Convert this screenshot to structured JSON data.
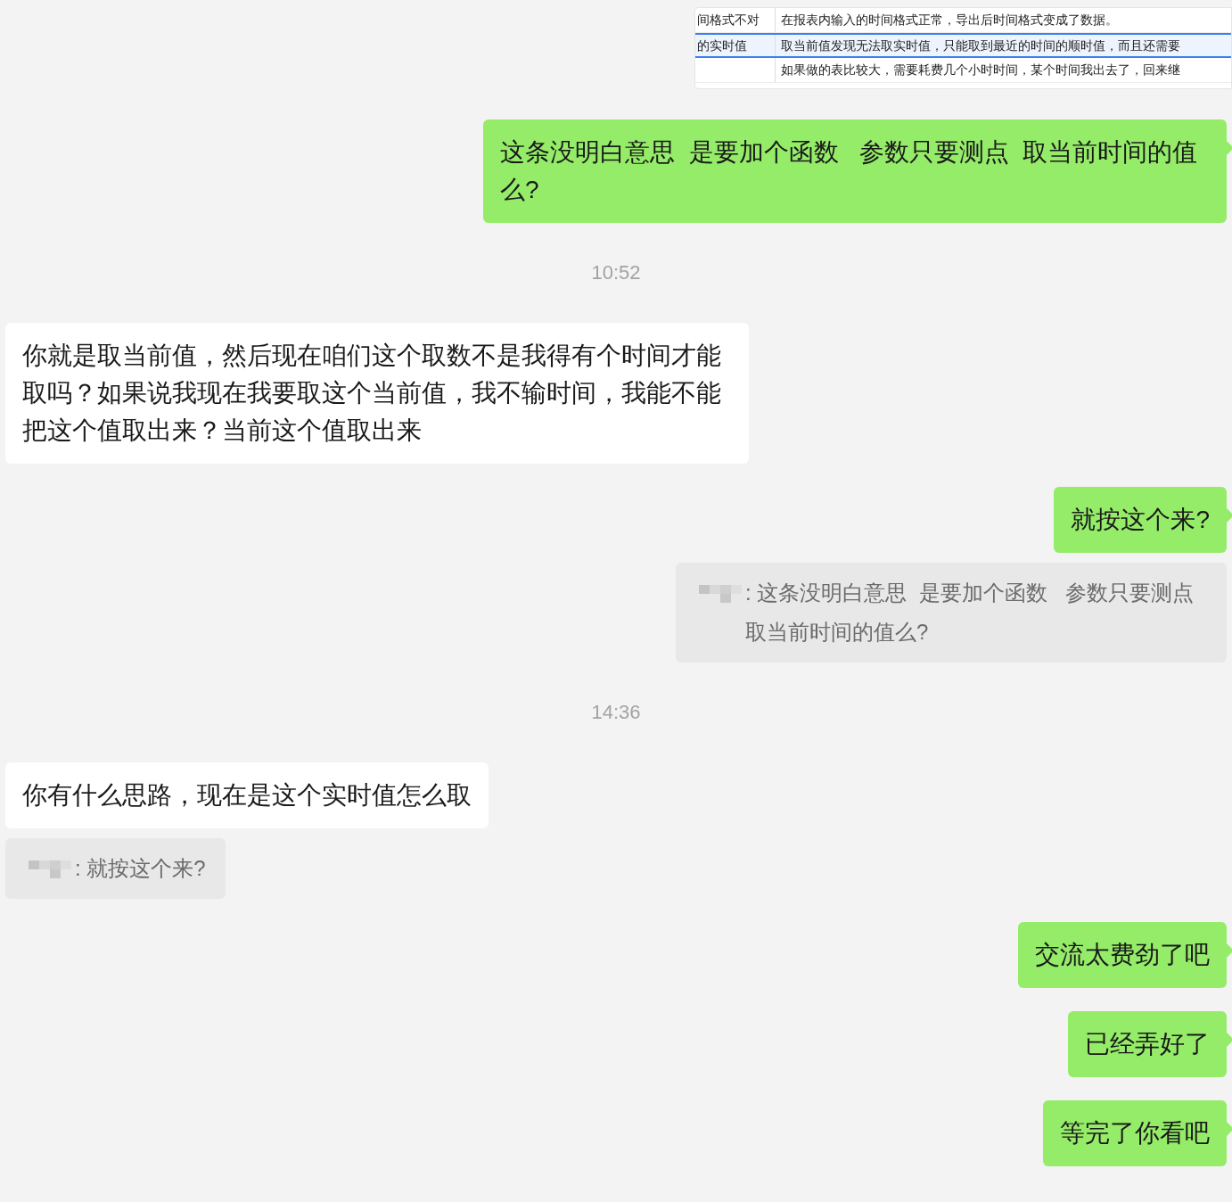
{
  "messages": [
    {
      "kind": "table-image",
      "outgoing": true,
      "rows": [
        {
          "cells": [
            "间格式不对",
            "在报表内输入的时间格式正常，导出后时间格式变成了数据。"
          ],
          "selected": false
        },
        {
          "cells": [
            "的实时值",
            "取当前值发现无法取实时值，只能取到最近的时间的顺时值，而且还需要"
          ],
          "selected": true
        },
        {
          "cells": [
            "",
            "如果做的表比较大，需要耗费几个小时时间，某个时间我出去了，回来继"
          ],
          "selected": false
        }
      ]
    },
    {
      "kind": "text",
      "outgoing": true,
      "text": "这条没明白意思  是要加个函数   参数只要测点  取当前时间的值么?"
    },
    {
      "kind": "time",
      "text": "10:52"
    },
    {
      "kind": "text",
      "outgoing": false,
      "text": "你就是取当前值，然后现在咱们这个取数不是我得有个时间才能取吗？如果说我现在我要取这个当前值，我不输时间，我能不能把这个值取出来？当前这个值取出来"
    },
    {
      "kind": "text",
      "outgoing": true,
      "text": "就按这个来?"
    },
    {
      "kind": "quote",
      "text": ": 这条没明白意思  是要加个函数   参数只要测点取当前时间的值么?"
    },
    {
      "kind": "time",
      "text": "14:36"
    },
    {
      "kind": "text",
      "outgoing": false,
      "text": "你有什么思路，现在是这个实时值怎么取"
    },
    {
      "kind": "quote",
      "text": ": 就按这个来?"
    },
    {
      "kind": "text",
      "outgoing": true,
      "text": "交流太费劲了吧"
    },
    {
      "kind": "text",
      "outgoing": true,
      "text": "已经弄好了"
    },
    {
      "kind": "text",
      "outgoing": true,
      "text": "等完了你看吧"
    }
  ]
}
